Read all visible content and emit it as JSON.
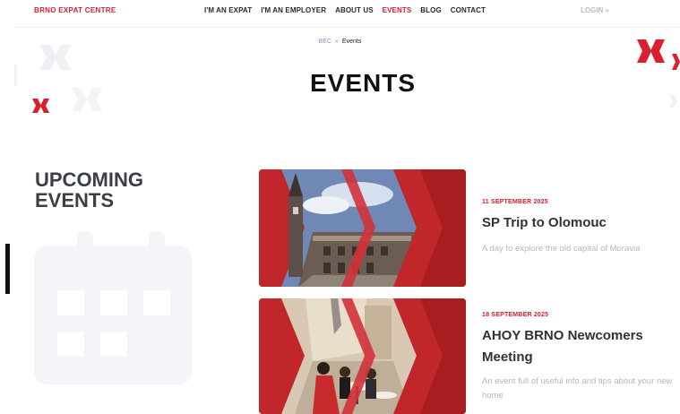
{
  "header": {
    "brand": "BRNO EXPAT CENTRE",
    "nav": [
      {
        "label": "I'M AN EXPAT",
        "active": false
      },
      {
        "label": "I'M AN EMPLOYER",
        "active": false
      },
      {
        "label": "ABOUT US",
        "active": false
      },
      {
        "label": "EVENTS",
        "active": true
      },
      {
        "label": "BLOG",
        "active": false
      },
      {
        "label": "CONTACT",
        "active": false
      }
    ],
    "login": "LOGIN »"
  },
  "breadcrumb": {
    "home": "BEC",
    "separator": "»",
    "current": "Events"
  },
  "page_title": "EVENTS",
  "upcoming": {
    "title_line1": "UPCOMING",
    "title_line2": "EVENTS"
  },
  "events": [
    {
      "date": "11 SEPTEMBER 2025",
      "title": "SP Trip to Olomouc",
      "description": "A day to explore the old capital of Moravia"
    },
    {
      "date": "18 SEPTEMBER 2025",
      "title": "AHOY BRNO Newcomers Meeting",
      "description": "An event full of useful info and tips about your new home"
    }
  ],
  "colors": {
    "brand_red": "#d8202f",
    "dark_text": "#2f3338",
    "muted_text": "#b4b8be",
    "calendar_bg": "#f3f5f9"
  }
}
